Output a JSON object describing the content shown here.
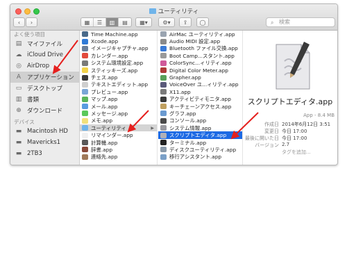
{
  "window": {
    "title": "ユーティリティ",
    "search_placeholder": "検索"
  },
  "sidebar": {
    "section_favorites": "よく使う項目",
    "section_devices": "デバイス",
    "favorites": [
      {
        "label": "マイファイル",
        "icon": "my-files-icon"
      },
      {
        "label": "iCloud Drive",
        "icon": "cloud-icon"
      },
      {
        "label": "AirDrop",
        "icon": "airdrop-icon"
      },
      {
        "label": "アプリケーション",
        "icon": "applications-icon"
      },
      {
        "label": "デスクトップ",
        "icon": "desktop-icon"
      },
      {
        "label": "書類",
        "icon": "documents-icon"
      },
      {
        "label": "ダウンロード",
        "icon": "download-icon"
      }
    ],
    "devices": [
      {
        "label": "Macintosh HD",
        "icon": "hard-drive-icon"
      },
      {
        "label": "Mavericks1",
        "icon": "hard-drive-icon"
      },
      {
        "label": "2TB3",
        "icon": "hard-drive-icon"
      }
    ]
  },
  "column1": [
    {
      "label": "Time Machine.app",
      "color": "#4a6a8a"
    },
    {
      "label": "Xcode.app",
      "color": "#2f7ad6"
    },
    {
      "label": "イメージキャプチャ.app",
      "color": "#6a7f9a"
    },
    {
      "label": "カレンダー.app",
      "color": "#e24a3c"
    },
    {
      "label": "システム環境設定.app",
      "color": "#7a7a7a"
    },
    {
      "label": "スティッキーズ.app",
      "color": "#f2d24a"
    },
    {
      "label": "チェス.app",
      "color": "#3a3a3a"
    },
    {
      "label": "テキストエディット.app",
      "color": "#cfcfcf"
    },
    {
      "label": "プレビュー.app",
      "color": "#7aa6d6"
    },
    {
      "label": "マップ.app",
      "color": "#5bb55b"
    },
    {
      "label": "メール.app",
      "color": "#5a9ce0"
    },
    {
      "label": "メッセージ.app",
      "color": "#5ac85a"
    },
    {
      "label": "メモ.app",
      "color": "#f2e07a"
    },
    {
      "label": "ユーティリティ",
      "color": "#6fb4ea"
    },
    {
      "label": "リマインダー.app",
      "color": "#f0f0f0"
    },
    {
      "label": "計算機.app",
      "color": "#5a5a5a"
    },
    {
      "label": "辞書.app",
      "color": "#8a4a3a"
    },
    {
      "label": "連絡先.app",
      "color": "#a07a5a"
    }
  ],
  "column2": [
    {
      "label": "AirMac ユーティリティ.app",
      "color": "#9aa4b0"
    },
    {
      "label": "Audio MIDI 設定.app",
      "color": "#8a8a8a"
    },
    {
      "label": "Bluetooth ファイル交換.app",
      "color": "#3a7ad6"
    },
    {
      "label": "Boot Camp...スタント.app",
      "color": "#9a9a9a"
    },
    {
      "label": "ColorSync...ィリティ.app",
      "color": "#d05a9a"
    },
    {
      "label": "Digital Color Meter.app",
      "color": "#b03a3a"
    },
    {
      "label": "Grapher.app",
      "color": "#5aa05a"
    },
    {
      "label": "VoiceOver ユ...ィリティ.app",
      "color": "#5a5a7a"
    },
    {
      "label": "X11.app",
      "color": "#7a7a7a"
    },
    {
      "label": "アクティビティモニタ.app",
      "color": "#3a3a3a"
    },
    {
      "label": "キーチェーンアクセス.app",
      "color": "#c0a060"
    },
    {
      "label": "グラフ.app",
      "color": "#6a9ad0"
    },
    {
      "label": "コンソール.app",
      "color": "#4a4a4a"
    },
    {
      "label": "システム情報.app",
      "color": "#9a9aa0"
    },
    {
      "label": "スクリプトエディタ.app",
      "color": "#b0b0b8"
    },
    {
      "label": "ターミナル.app",
      "color": "#222222"
    },
    {
      "label": "ディスクユーティリティ.app",
      "color": "#8a9aaa"
    },
    {
      "label": "移行アシスタント.app",
      "color": "#7aa0c8"
    }
  ],
  "preview": {
    "name": "スクリプトエディタ.app",
    "meta": "App - 8.4 MB",
    "info": [
      {
        "key": "作成日",
        "value": "2014年6月12日 3:51"
      },
      {
        "key": "変更日",
        "value": "今日 17:00"
      },
      {
        "key": "最後に開いた日",
        "value": "今日 17:00"
      },
      {
        "key": "バージョン",
        "value": "2.7"
      },
      {
        "key": "",
        "value": "タグを追加..."
      }
    ]
  }
}
